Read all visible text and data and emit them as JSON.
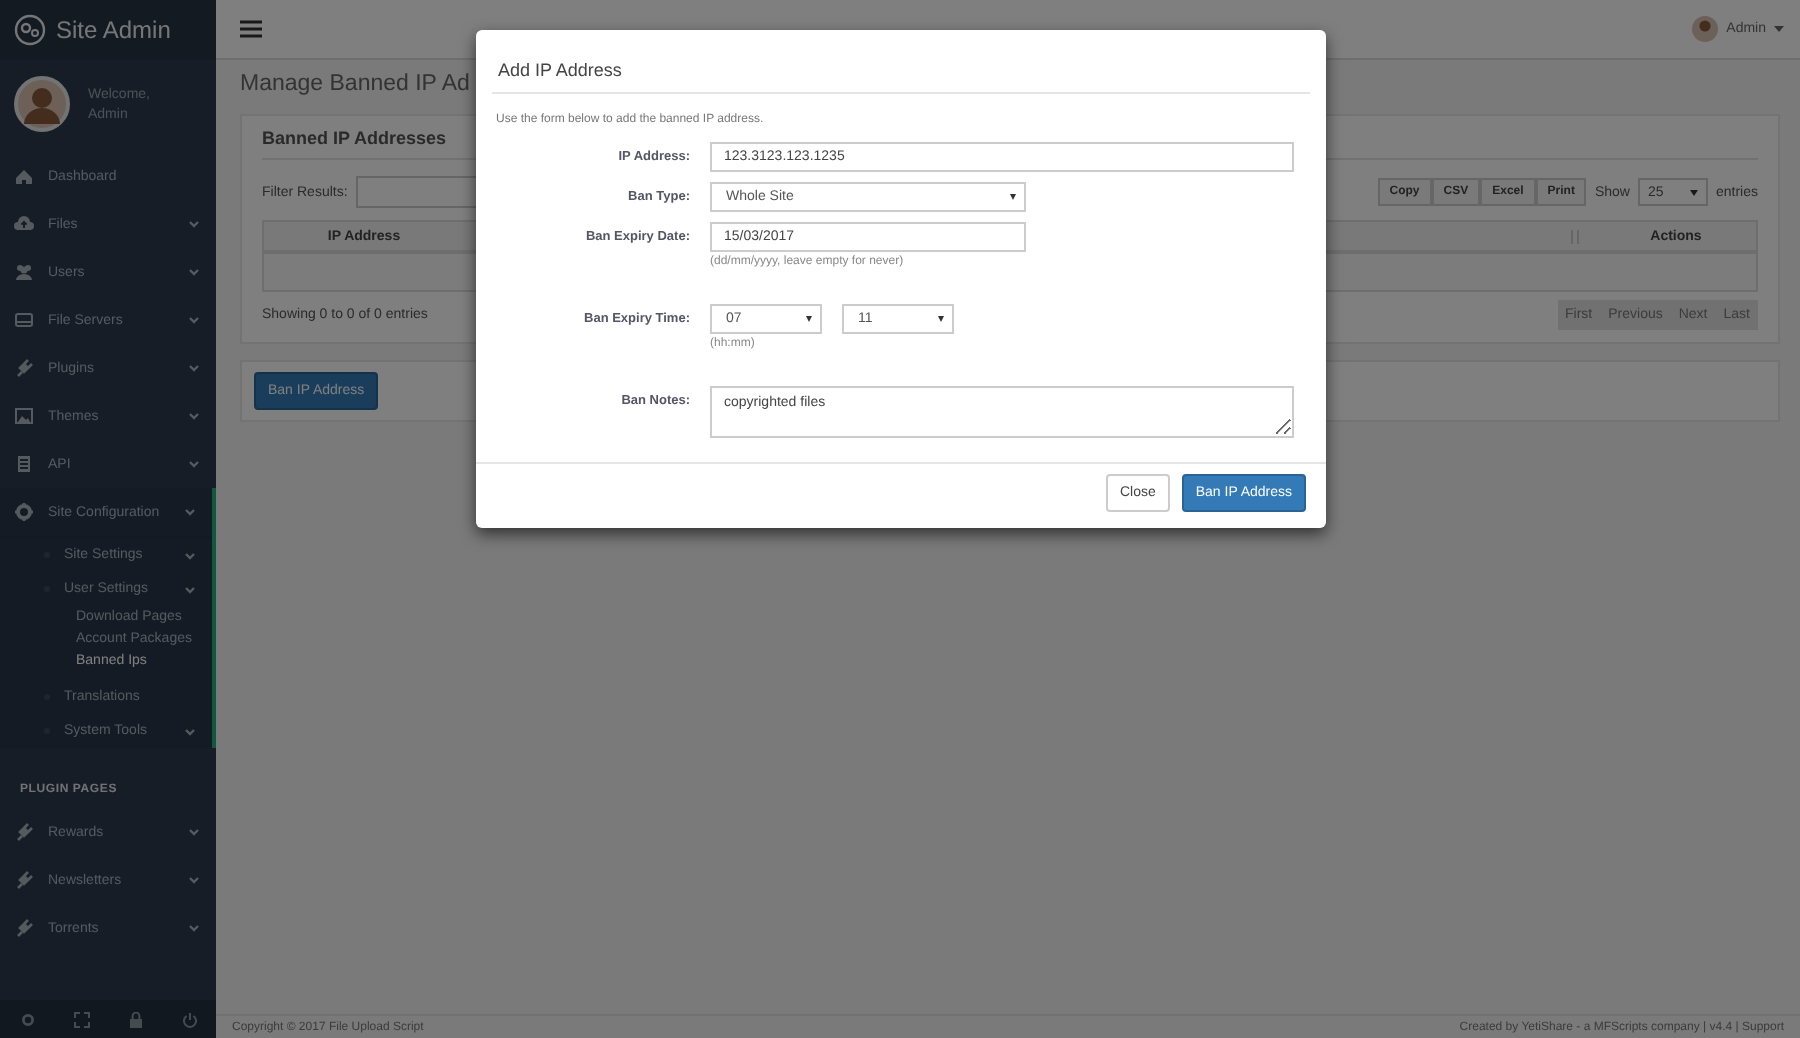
{
  "sidebar": {
    "brand": "Site Admin",
    "welcome": "Welcome,",
    "user": "Admin",
    "items": [
      {
        "label": "Dashboard",
        "kind": "link",
        "selected": false
      },
      {
        "label": "Files",
        "kind": "menu",
        "selected": false
      },
      {
        "label": "Users",
        "kind": "menu",
        "selected": false
      },
      {
        "label": "File Servers",
        "kind": "menu",
        "selected": false
      },
      {
        "label": "Plugins",
        "kind": "menu",
        "selected": false
      },
      {
        "label": "Themes",
        "kind": "menu",
        "selected": false
      },
      {
        "label": "API",
        "kind": "menu",
        "selected": false
      },
      {
        "label": "Site Configuration",
        "kind": "menu",
        "expanded": true,
        "selected": false,
        "children": [
          {
            "label": "Site Settings",
            "kind": "menu",
            "selected": false
          },
          {
            "label": "User Settings",
            "kind": "menu",
            "expanded": true,
            "selected": false,
            "children": [
              {
                "label": "Download Pages",
                "kind": "link",
                "selected": false
              },
              {
                "label": "Account Packages",
                "kind": "link",
                "selected": false
              },
              {
                "label": "Banned Ips",
                "kind": "link",
                "selected": true
              }
            ]
          },
          {
            "label": "Translations",
            "kind": "link",
            "selected": false
          },
          {
            "label": "System Tools",
            "kind": "menu",
            "selected": false
          }
        ]
      }
    ],
    "section_heading": "PLUGIN PAGES",
    "plugin_items": [
      {
        "label": "Rewards",
        "kind": "menu",
        "selected": false
      },
      {
        "label": "Newsletters",
        "kind": "menu",
        "selected": false
      },
      {
        "label": "Torrents",
        "kind": "menu",
        "selected": false
      }
    ]
  },
  "header": {
    "user": "Admin"
  },
  "page": {
    "title": "Manage Banned IP Ad",
    "panel_title": "Banned IP Addresses",
    "filter_label": "Filter Results:",
    "export_buttons": [
      "Copy",
      "CSV",
      "Excel",
      "Print"
    ],
    "show_label": "Show",
    "page_size": "25",
    "entries_label": "entries",
    "columns": [
      "IP Address",
      "Actions"
    ],
    "info": "Showing 0 to 0 of 0 entries",
    "pagination": [
      "First",
      "Previous",
      "Next",
      "Last"
    ],
    "ban_button": "Ban IP Address"
  },
  "modal": {
    "title": "Add IP Address",
    "intro": "Use the form below to add the banned IP address.",
    "fields": [
      {
        "kind": "text",
        "label": "IP Address:",
        "value": "123.3123.123.1235"
      },
      {
        "kind": "select",
        "label": "Ban Type:",
        "value": "Whole Site"
      },
      {
        "kind": "date",
        "label": "Ban Expiry Date:",
        "value": "15/03/2017",
        "hint": "(dd/mm/yyyy, leave empty for never)"
      },
      {
        "kind": "time",
        "label": "Ban Expiry Time:",
        "hour": "07",
        "minute": "11",
        "hint": "(hh:mm)"
      },
      {
        "kind": "textarea",
        "label": "Ban Notes:",
        "value": "copyrighted files"
      }
    ],
    "buttons": [
      {
        "label": "Close",
        "kind": "default"
      },
      {
        "label": "Ban IP Address",
        "kind": "primary"
      }
    ]
  },
  "footer": {
    "left": "Copyright © 2017 File Upload Script",
    "right": "Created by YetiShare - a MFScripts company | v4.4 | Support"
  }
}
